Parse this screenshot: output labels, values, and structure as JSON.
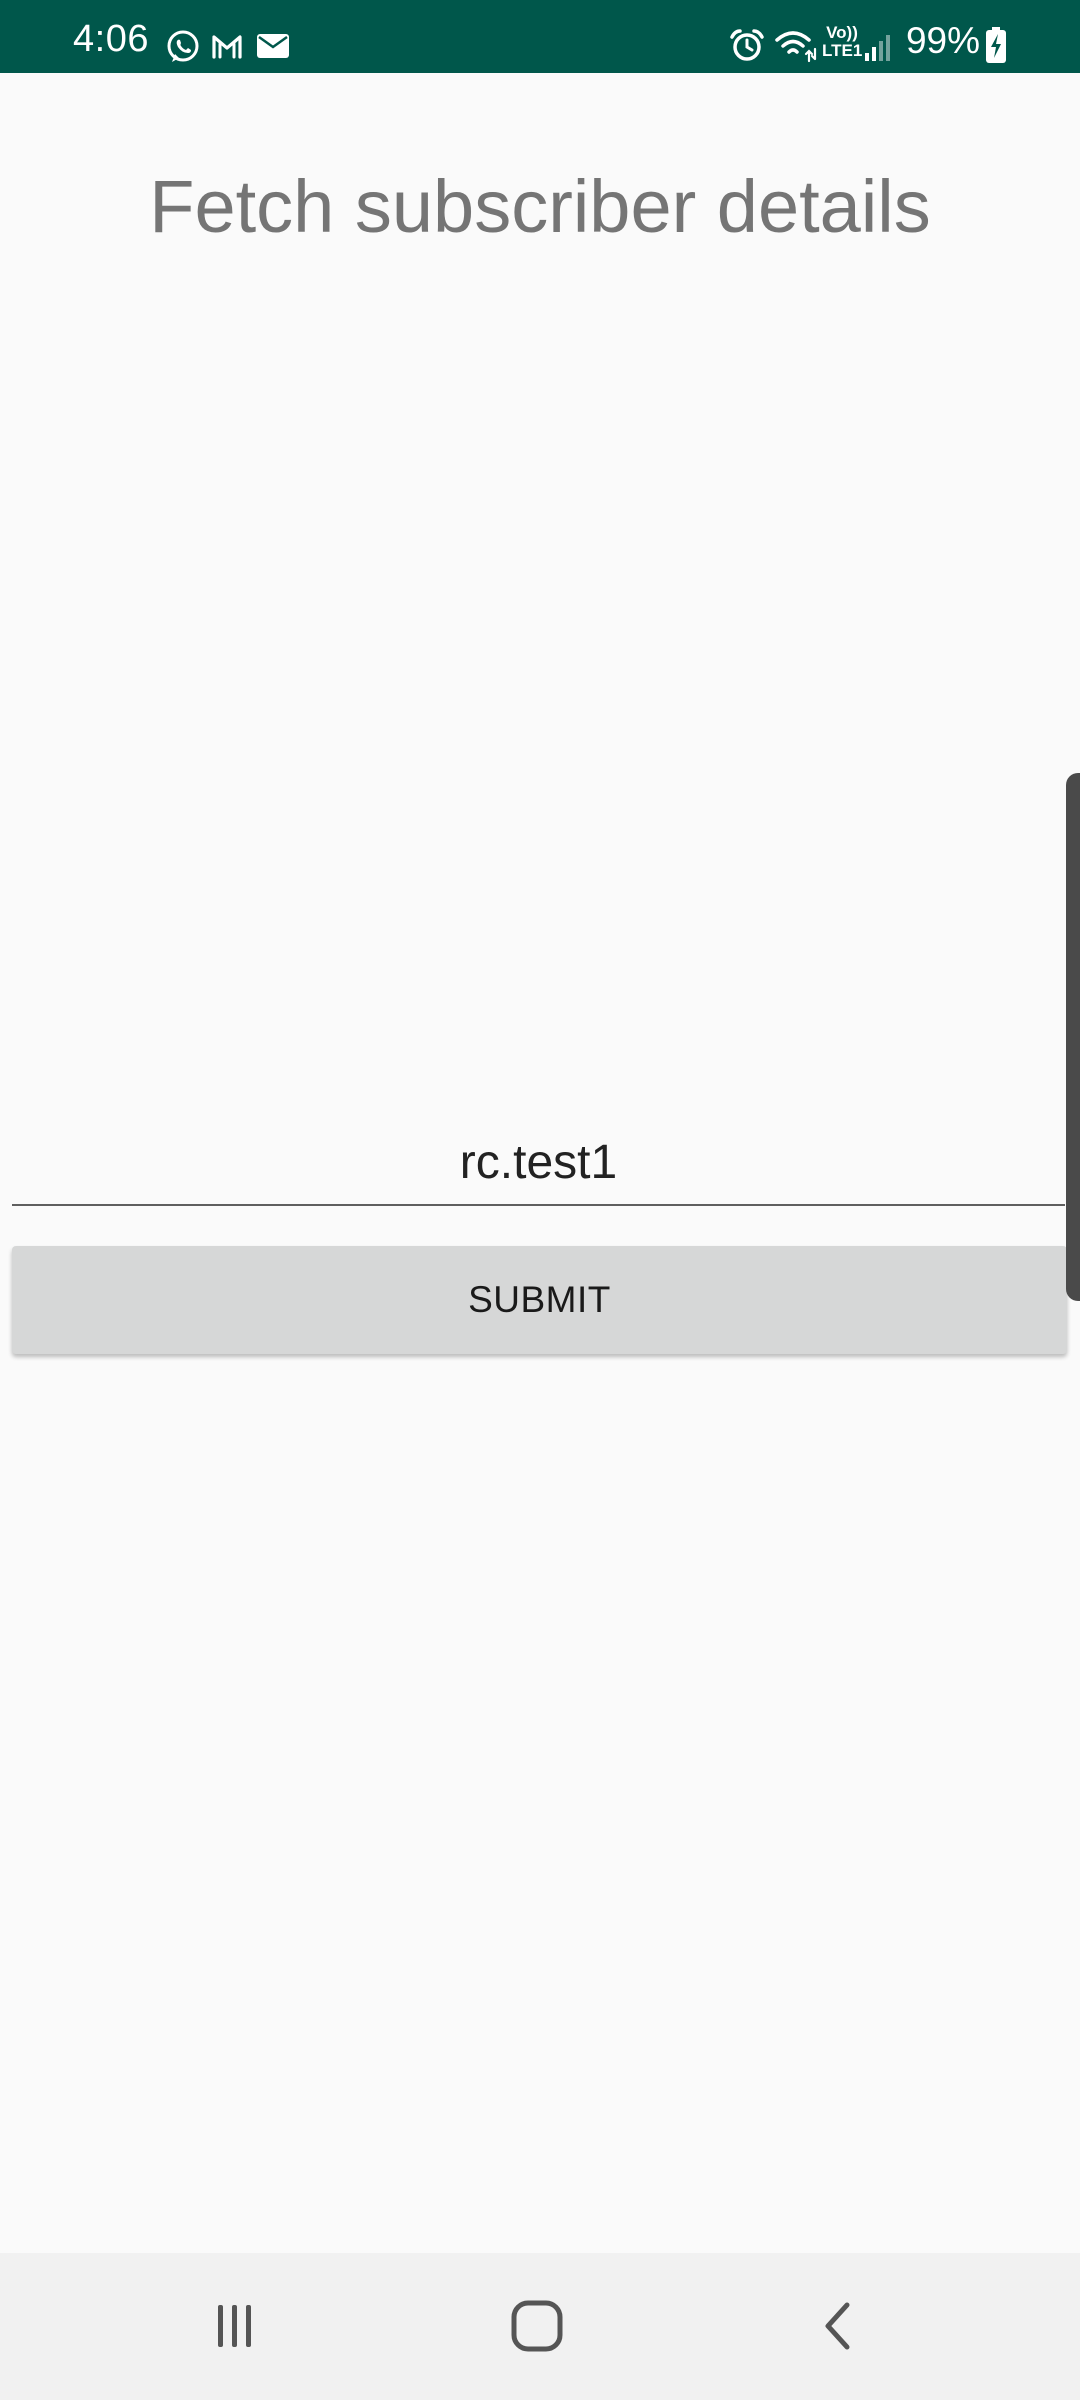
{
  "status_bar": {
    "time": "4:06",
    "battery": "99%",
    "left_icons": [
      "whatsapp-icon",
      "gmail-icon",
      "email-icon"
    ],
    "right_icons": [
      "alarm-icon",
      "wifi-icon",
      "volte-icon",
      "signal-icon",
      "battery-charging-icon"
    ],
    "volte_top": "Vo))",
    "volte_bottom": "LTE1",
    "background_color": "#00574b"
  },
  "page": {
    "title": "Fetch subscriber details"
  },
  "form": {
    "username_value": "rc.test1",
    "submit_label": "SUBMIT"
  },
  "nav_bar": {
    "buttons": [
      "recent-apps-icon",
      "home-icon",
      "back-icon"
    ]
  }
}
